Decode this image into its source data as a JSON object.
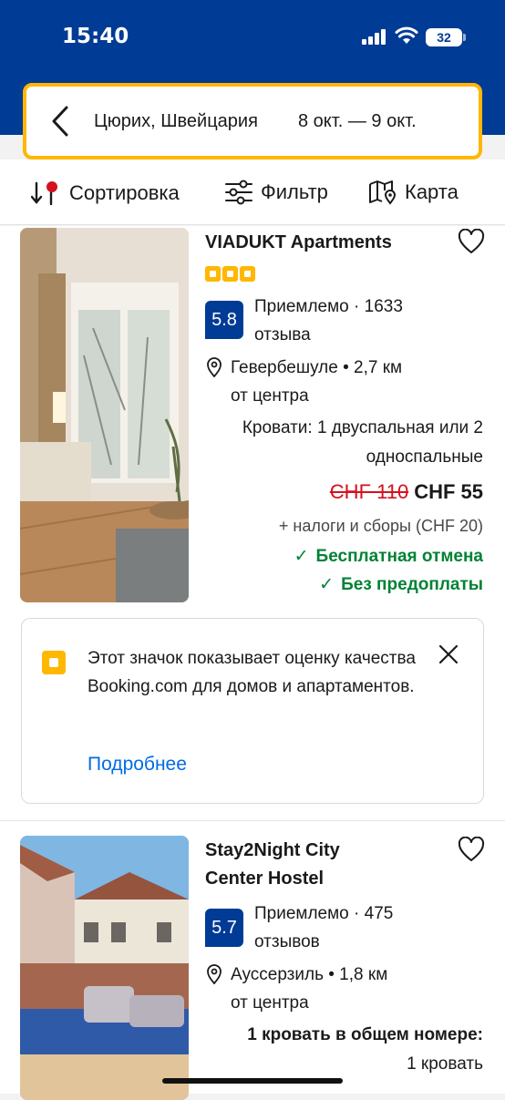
{
  "status": {
    "time": "15:40",
    "battery": "32"
  },
  "search": {
    "city": "Цюрих, Швейцария",
    "dates": "8 окт. — 9 окт."
  },
  "toolbar": {
    "sort": "Сортировка",
    "filter": "Фильтр",
    "map": "Карта"
  },
  "properties": [
    {
      "name": "VIADUKT Apartments",
      "quality_badges": 3,
      "score": "5.8",
      "rating_text_1": "Приемлемо · 1633",
      "rating_text_2": "отзыва",
      "location_1": "Гевербешуле • 2,7 км",
      "location_2": "от центра",
      "beds_1": "Кровати: 1 двуспальная или 2",
      "beds_2": "односпальные",
      "old_price": "CHF 110",
      "price": "CHF 55",
      "taxes": "+ налоги и сборы (CHF 20)",
      "perk_1": "Бесплатная отмена",
      "perk_2": "Без предоплаты"
    },
    {
      "name_1": "Stay2Night City",
      "name_2": "Center Hostel",
      "score": "5.7",
      "rating_text_1": "Приемлемо · 475",
      "rating_text_2": "отзывов",
      "location_1": "Ауссерзиль • 1,8 км",
      "location_2": "от центра",
      "beds_1": "1 кровать в общем номере:",
      "beds_2": "1 кровать"
    }
  ],
  "notice": {
    "text": "Этот значок показывает оценку качества Booking.com для домов и апартаментов.",
    "link": "Подробнее"
  },
  "colors": {
    "brand": "#003b95",
    "accent": "#ffb700",
    "link": "#006ce4",
    "green": "#008234",
    "red": "#d4111e"
  }
}
